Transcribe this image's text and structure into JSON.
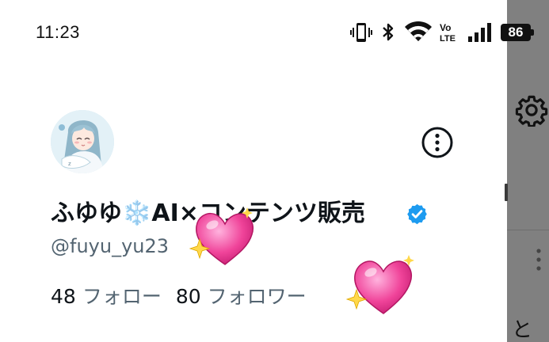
{
  "status_bar": {
    "time": "11:23",
    "icons": [
      "vibrate-icon",
      "bluetooth-icon",
      "wifi-icon",
      "volte-icon",
      "signal-icon"
    ],
    "volte_text": "Vo LTE",
    "battery_level": "86"
  },
  "profile": {
    "display_name": "ふゆゆ❄️AI×コンテンツ販売",
    "handle": "@fuyu_yu23",
    "following_count": "48",
    "following_label": "フォロー",
    "followers_count": "80",
    "followers_label": "フォロワー",
    "verified": true
  },
  "background": {
    "partial_text": "と"
  },
  "colors": {
    "verified_blue": "#1d9bf0",
    "secondary_text": "#536471",
    "primary_text": "#0f1419",
    "scrim": "#808080"
  }
}
